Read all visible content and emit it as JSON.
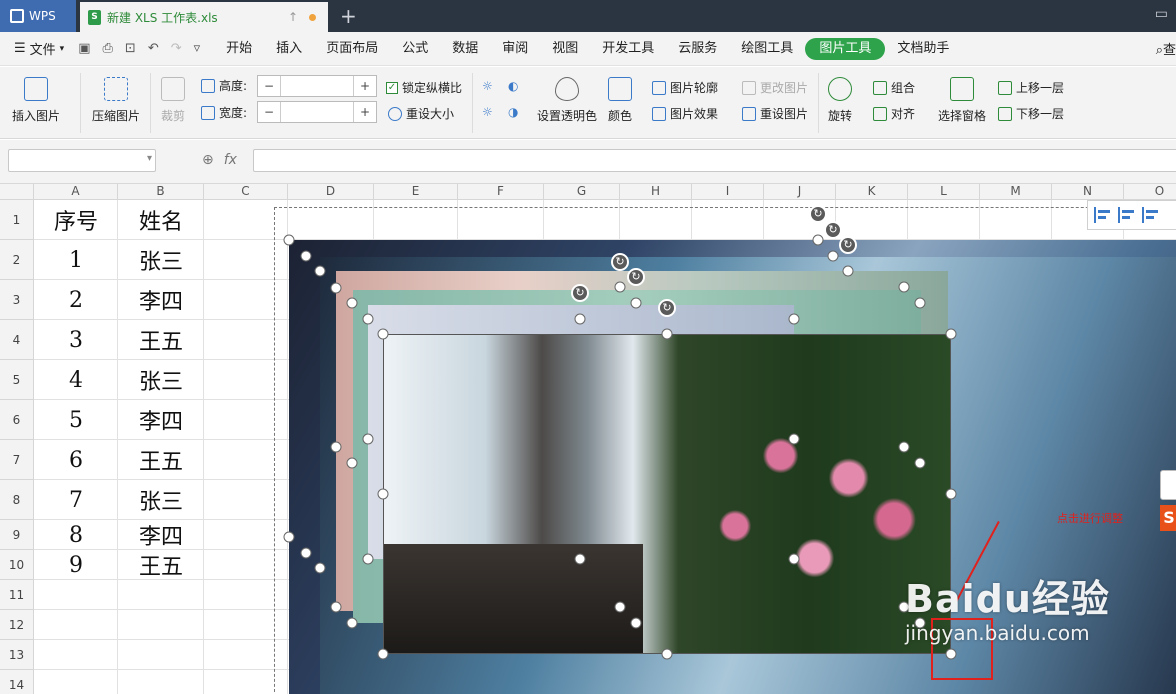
{
  "titlebar": {
    "app_tab": "WPS",
    "doc_tab": "新建 XLS 工作表.xls",
    "doc_icon": "S"
  },
  "menubar": {
    "file": "文件",
    "items": [
      "开始",
      "插入",
      "页面布局",
      "公式",
      "数据",
      "审阅",
      "视图",
      "开发工具",
      "云服务",
      "绘图工具",
      "图片工具",
      "文档助手"
    ],
    "active": "图片工具",
    "search": "查"
  },
  "ribbon": {
    "insert_picture": "插入图片",
    "compress_picture": "压缩图片",
    "crop": "裁剪",
    "height_label": "高度:",
    "width_label": "宽度:",
    "height_value": "",
    "width_value": "",
    "lock_ratio": "锁定纵横比",
    "reset_size": "重设大小",
    "set_transparent": "设置透明色",
    "color": "颜色",
    "picture_outline": "图片轮廓",
    "picture_effect": "图片效果",
    "change_picture": "更改图片",
    "reset_picture": "重设图片",
    "rotate": "旋转",
    "group": "组合",
    "align": "对齐",
    "selection_pane": "选择窗格",
    "bring_forward": "上移一层",
    "send_backward": "下移一层",
    "colors": {
      "accent": "#2ea34b",
      "icon_blue": "#3b7ac9"
    }
  },
  "formula": {
    "fx": "fx",
    "name_value": "",
    "input_value": ""
  },
  "grid": {
    "columns": [
      "A",
      "B",
      "C",
      "D",
      "E",
      "F",
      "G",
      "H",
      "I",
      "J",
      "K",
      "L",
      "M",
      "N",
      "O"
    ],
    "rows": [
      "1",
      "2",
      "3",
      "4",
      "5",
      "6",
      "7",
      "8",
      "9",
      "10",
      "11",
      "12",
      "13",
      "14"
    ],
    "col_a": [
      "序号",
      "1",
      "2",
      "3",
      "4",
      "5",
      "6",
      "7",
      "8",
      "9"
    ],
    "col_b": [
      "姓名",
      "张三",
      "李四",
      "王五",
      "张三",
      "李四",
      "王五",
      "张三",
      "李四",
      "王五"
    ]
  },
  "annotation": {
    "text": "点击进行调整",
    "color": "#e0211c"
  },
  "watermark": {
    "brand": "Baidu经验",
    "url": "jingyan.baidu.com"
  }
}
